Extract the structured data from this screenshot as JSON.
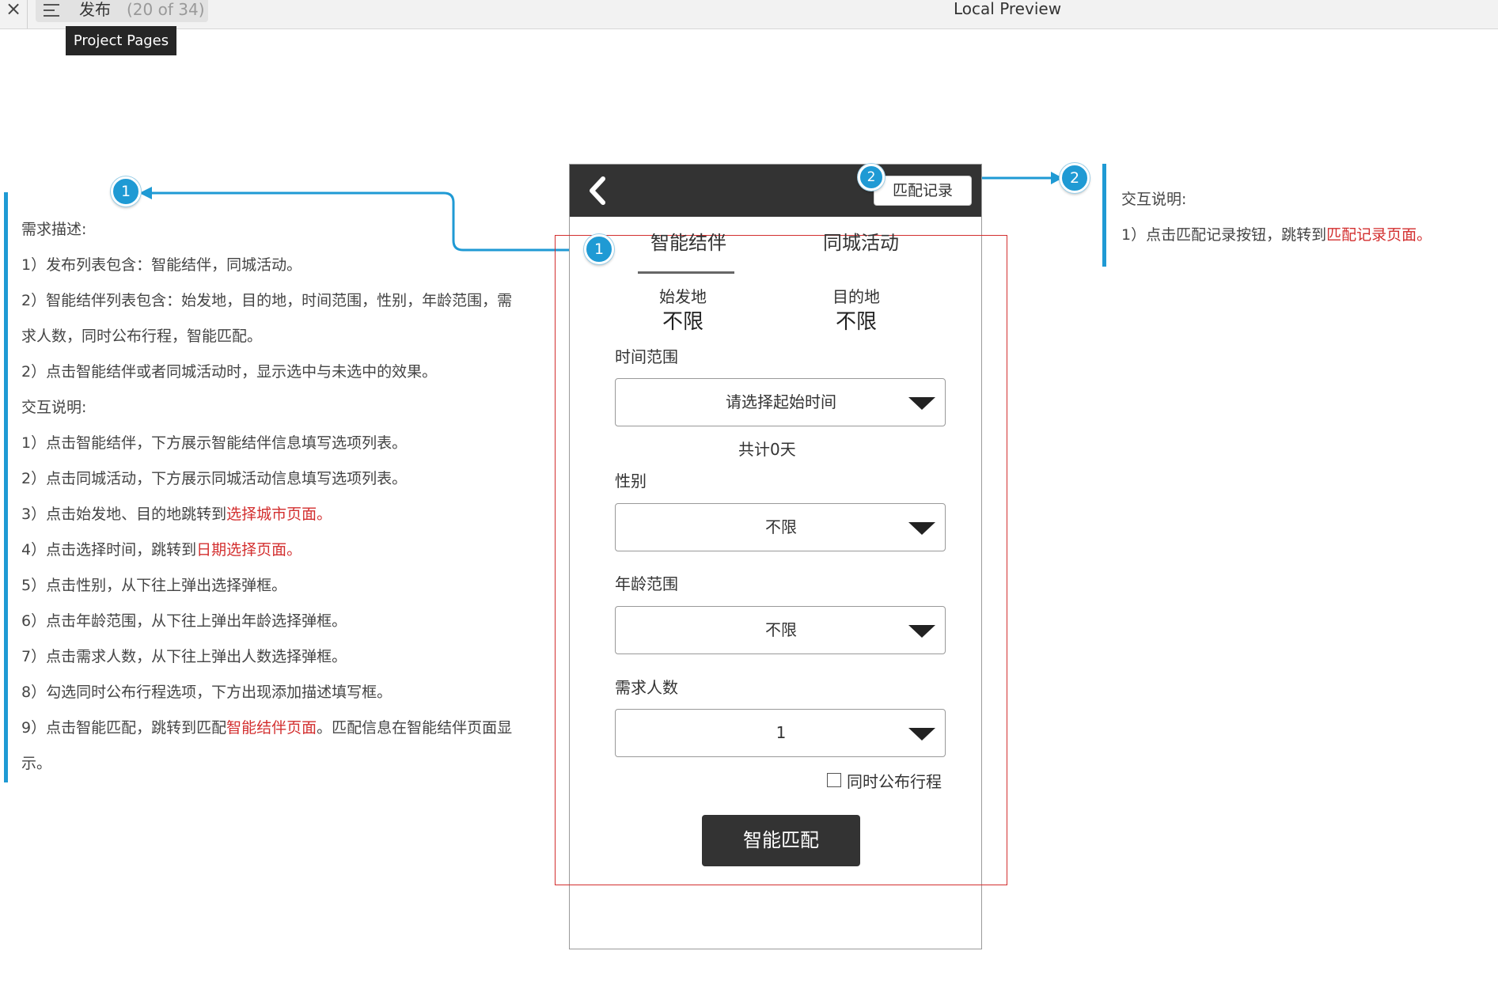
{
  "topbar": {
    "close_glyph": "×",
    "page_name": "发布",
    "page_count": "(20 of 34)",
    "preview_title": "Local Preview",
    "tooltip": "Project Pages"
  },
  "left_notes": [
    {
      "text": "需求描述:",
      "link": ""
    },
    {
      "text": "1）发布列表包含：智能结伴，同城活动。",
      "link": ""
    },
    {
      "text": "2）智能结伴列表包含：始发地，目的地，时间范围，性别，年龄范围，需",
      "link": ""
    },
    {
      "text": "求人数，同时公布行程，智能匹配。",
      "link": ""
    },
    {
      "text": "2）点击智能结伴或者同城活动时，显示选中与未选中的效果。",
      "link": ""
    },
    {
      "text": "交互说明:",
      "link": ""
    },
    {
      "text": "1）点击智能结伴，下方展示智能结伴信息填写选项列表。",
      "link": ""
    },
    {
      "text": "2）点击同城活动，下方展示同城活动信息填写选项列表。",
      "link": ""
    },
    {
      "text": "3）点击始发地、目的地跳转到",
      "link": "选择城市页面。"
    },
    {
      "text": "4）点击选择时间，跳转到",
      "link": "日期选择页面。"
    },
    {
      "text": "5）点击性别，从下往上弹出选择弹框。",
      "link": ""
    },
    {
      "text": "6）点击年龄范围，从下往上弹出年龄选择弹框。",
      "link": ""
    },
    {
      "text": "7）点击需求人数，从下往上弹出人数选择弹框。",
      "link": ""
    },
    {
      "text": "8）勾选同时公布行程选项，下方出现添加描述填写框。",
      "link": ""
    },
    {
      "text": "9）点击智能匹配，跳转到匹配",
      "link": "智能结伴页面",
      "after": "。匹配信息在智能结伴页面显"
    },
    {
      "text": "示。",
      "link": ""
    }
  ],
  "right_notes": [
    {
      "text": "交互说明:",
      "link": ""
    },
    {
      "text": "1）点击匹配记录按钮，跳转到",
      "link": "匹配记录页面。"
    }
  ],
  "markers": {
    "one": "1",
    "two": "2"
  },
  "phone": {
    "record_button": "匹配记录",
    "tabs": [
      {
        "label": "智能结伴",
        "selected": true
      },
      {
        "label": "同城活动",
        "selected": false
      }
    ],
    "origin": {
      "label": "始发地",
      "value": "不限"
    },
    "destination": {
      "label": "目的地",
      "value": "不限"
    },
    "time_range": {
      "label": "时间范围",
      "value": "请选择起始时间"
    },
    "total_days": "共计0天",
    "gender": {
      "label": "性别",
      "value": "不限"
    },
    "age_range": {
      "label": "年龄范围",
      "value": "不限"
    },
    "people_count": {
      "label": "需求人数",
      "value": "1"
    },
    "publish_checkbox": {
      "label": "同时公布行程",
      "checked": false
    },
    "match_button": "智能匹配"
  },
  "colors": {
    "accent": "#1f9ad4",
    "link_red": "#d32f2f",
    "header_dark": "#333333"
  }
}
